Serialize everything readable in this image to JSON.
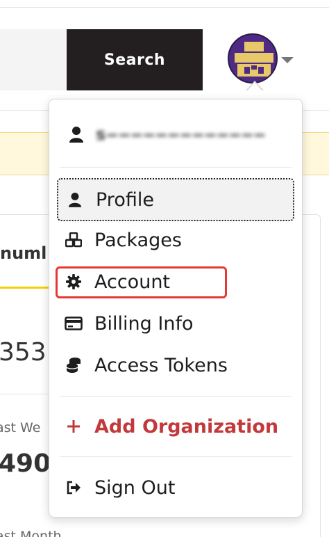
{
  "header": {
    "search_label": "Search",
    "search_placeholder": ""
  },
  "background": {
    "tab_label": "numl",
    "stat_1": "353",
    "label_2": "ast We",
    "stat_2": "490",
    "label_3": "ast Month"
  },
  "user_menu": {
    "username": "s‒‒‒‒‒‒‒‒‒‒‒‒‒",
    "items": [
      {
        "label": "Profile",
        "icon": "user-icon"
      },
      {
        "label": "Packages",
        "icon": "cubes-icon"
      },
      {
        "label": "Account",
        "icon": "gear-icon"
      },
      {
        "label": "Billing Info",
        "icon": "credit-card-icon"
      },
      {
        "label": "Access Tokens",
        "icon": "coins-icon"
      }
    ],
    "add_org_label": "Add Organization",
    "sign_out_label": "Sign Out"
  },
  "colors": {
    "search_button_bg": "#231f20",
    "avatar_bg": "#4e2a84",
    "avatar_pattern": "#e8c96a",
    "alert_bg": "#fff8dc",
    "accent_yellow": "#f2d200",
    "add_org_red": "#c2393c",
    "highlight_red": "#e53935"
  }
}
